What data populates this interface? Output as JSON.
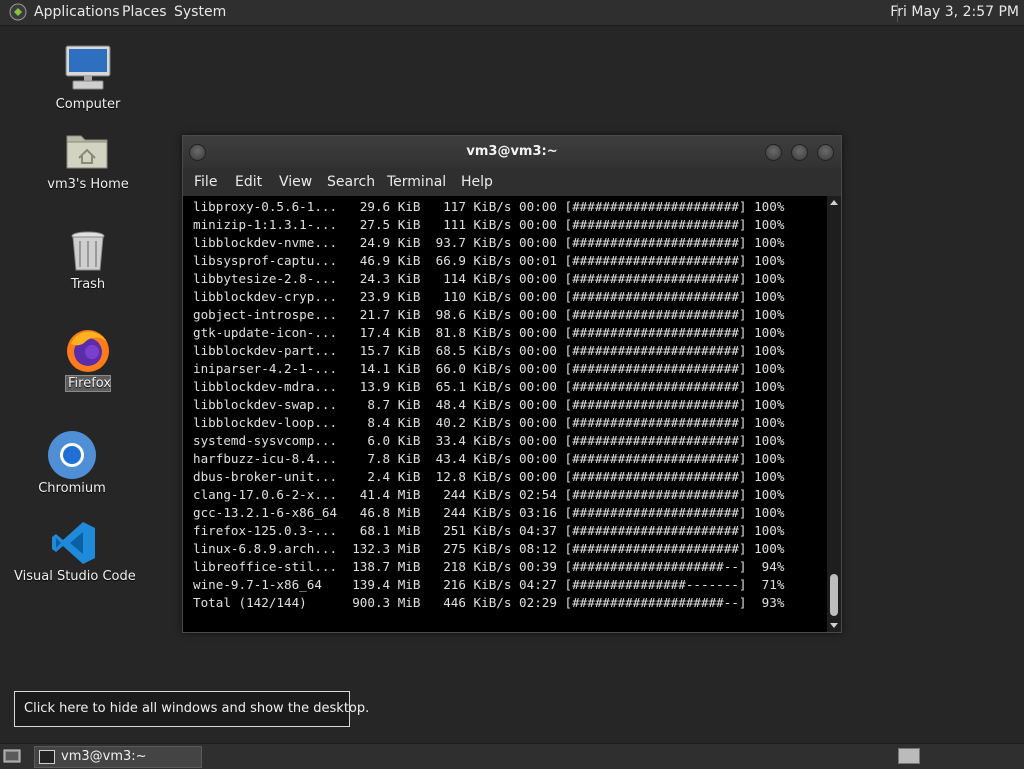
{
  "top_panel": {
    "menus": [
      "Applications",
      "Places",
      "System"
    ],
    "clock": "Fri May  3,  2:57 PM"
  },
  "desktop_icons": [
    {
      "label": "Computer"
    },
    {
      "label": "vm3's Home"
    },
    {
      "label": "Trash"
    },
    {
      "label": "Firefox"
    },
    {
      "label": "Chromium"
    },
    {
      "label": "Visual Studio Code"
    }
  ],
  "terminal": {
    "title": "vm3@vm3:~",
    "menus": [
      "File",
      "Edit",
      "View",
      "Search",
      "Terminal",
      "Help"
    ],
    "lines": [
      {
        "name": "libproxy-0.5.6-1...",
        "size": "29.6 KiB",
        "speed": "117 KiB/s",
        "time": "00:00",
        "bar": "[######################]",
        "pct": "100%"
      },
      {
        "name": "minizip-1:1.3.1-...",
        "size": "27.5 KiB",
        "speed": "111 KiB/s",
        "time": "00:00",
        "bar": "[######################]",
        "pct": "100%"
      },
      {
        "name": "libblockdev-nvme...",
        "size": "24.9 KiB",
        "speed": "93.7 KiB/s",
        "time": "00:00",
        "bar": "[######################]",
        "pct": "100%"
      },
      {
        "name": "libsysprof-captu...",
        "size": "46.9 KiB",
        "speed": "66.9 KiB/s",
        "time": "00:01",
        "bar": "[######################]",
        "pct": "100%"
      },
      {
        "name": "libbytesize-2.8-...",
        "size": "24.3 KiB",
        "speed": "114 KiB/s",
        "time": "00:00",
        "bar": "[######################]",
        "pct": "100%"
      },
      {
        "name": "libblockdev-cryp...",
        "size": "23.9 KiB",
        "speed": "110 KiB/s",
        "time": "00:00",
        "bar": "[######################]",
        "pct": "100%"
      },
      {
        "name": "gobject-introspe...",
        "size": "21.7 KiB",
        "speed": "98.6 KiB/s",
        "time": "00:00",
        "bar": "[######################]",
        "pct": "100%"
      },
      {
        "name": "gtk-update-icon-...",
        "size": "17.4 KiB",
        "speed": "81.8 KiB/s",
        "time": "00:00",
        "bar": "[######################]",
        "pct": "100%"
      },
      {
        "name": "libblockdev-part...",
        "size": "15.7 KiB",
        "speed": "68.5 KiB/s",
        "time": "00:00",
        "bar": "[######################]",
        "pct": "100%"
      },
      {
        "name": "iniparser-4.2-1-...",
        "size": "14.1 KiB",
        "speed": "66.0 KiB/s",
        "time": "00:00",
        "bar": "[######################]",
        "pct": "100%"
      },
      {
        "name": "libblockdev-mdra...",
        "size": "13.9 KiB",
        "speed": "65.1 KiB/s",
        "time": "00:00",
        "bar": "[######################]",
        "pct": "100%"
      },
      {
        "name": "libblockdev-swap...",
        "size": "8.7 KiB",
        "speed": "48.4 KiB/s",
        "time": "00:00",
        "bar": "[######################]",
        "pct": "100%"
      },
      {
        "name": "libblockdev-loop...",
        "size": "8.4 KiB",
        "speed": "40.2 KiB/s",
        "time": "00:00",
        "bar": "[######################]",
        "pct": "100%"
      },
      {
        "name": "systemd-sysvcomp...",
        "size": "6.0 KiB",
        "speed": "33.4 KiB/s",
        "time": "00:00",
        "bar": "[######################]",
        "pct": "100%"
      },
      {
        "name": "harfbuzz-icu-8.4...",
        "size": "7.8 KiB",
        "speed": "43.4 KiB/s",
        "time": "00:00",
        "bar": "[######################]",
        "pct": "100%"
      },
      {
        "name": "dbus-broker-unit...",
        "size": "2.4 KiB",
        "speed": "12.8 KiB/s",
        "time": "00:00",
        "bar": "[######################]",
        "pct": "100%"
      },
      {
        "name": "clang-17.0.6-2-x...",
        "size": "41.4 MiB",
        "speed": "244 KiB/s",
        "time": "02:54",
        "bar": "[######################]",
        "pct": "100%"
      },
      {
        "name": "gcc-13.2.1-6-x86_64",
        "size": "46.8 MiB",
        "speed": "244 KiB/s",
        "time": "03:16",
        "bar": "[######################]",
        "pct": "100%"
      },
      {
        "name": "firefox-125.0.3-...",
        "size": "68.1 MiB",
        "speed": "251 KiB/s",
        "time": "04:37",
        "bar": "[######################]",
        "pct": "100%"
      },
      {
        "name": "linux-6.8.9.arch...",
        "size": "132.3 MiB",
        "speed": "275 KiB/s",
        "time": "08:12",
        "bar": "[######################]",
        "pct": "100%"
      },
      {
        "name": "libreoffice-stil...",
        "size": "138.7 MiB",
        "speed": "218 KiB/s",
        "time": "00:39",
        "bar": "[####################--]",
        "pct": "94%"
      },
      {
        "name": "wine-9.7-1-x86_64",
        "size": "139.4 MiB",
        "speed": "216 KiB/s",
        "time": "04:27",
        "bar": "[###############-------]",
        "pct": "71%"
      },
      {
        "name": "Total (142/144)",
        "size": "900.3 MiB",
        "speed": "446 KiB/s",
        "time": "02:29",
        "bar": "[####################--]",
        "pct": "93%"
      }
    ]
  },
  "tooltip": {
    "text": "Click here to hide all windows and show the desktop."
  },
  "taskbar": {
    "terminal_label": "vm3@vm3:~"
  },
  "colors": {
    "panel": "#2f2f2f",
    "desktop": "#262626",
    "terminal_bg": "#000000",
    "terminal_fg": "#e0e0e0"
  }
}
